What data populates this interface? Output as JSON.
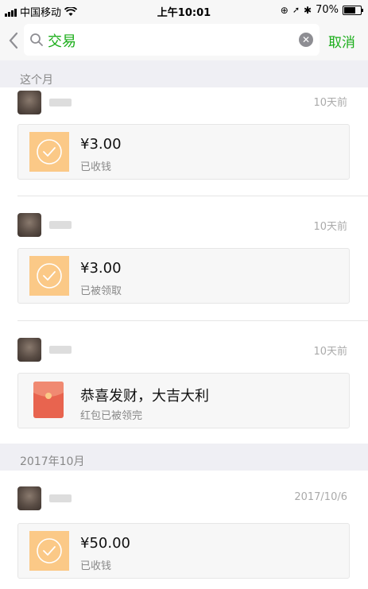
{
  "status_bar": {
    "carrier": "中国移动",
    "time": "上午10:01",
    "battery": "70%",
    "battery_level": 0.7
  },
  "search": {
    "query": "交易",
    "cancel_label": "取消"
  },
  "sections": [
    {
      "header": "这个月",
      "items": [
        {
          "time": "10天前",
          "title": "¥3.00",
          "subtitle": "已收钱",
          "icon": "transfer-icon"
        },
        {
          "time": "10天前",
          "title": "¥3.00",
          "subtitle": "已被领取",
          "icon": "transfer-icon"
        },
        {
          "time": "10天前",
          "title": "恭喜发财，大吉大利",
          "subtitle": "红包已被领完",
          "icon": "red-packet-icon"
        }
      ]
    },
    {
      "header": "2017年10月",
      "items": [
        {
          "time": "2017/10/6",
          "title": "¥50.00",
          "subtitle": "已收钱",
          "icon": "transfer-icon"
        }
      ]
    }
  ]
}
